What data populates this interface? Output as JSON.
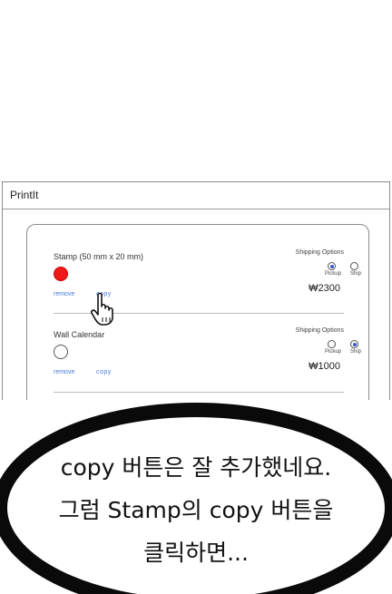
{
  "app": {
    "title": "PrintIt"
  },
  "items": [
    {
      "name": "Stamp (50 mm x 20 mm)",
      "swatch_color": "#ee1a1a",
      "remove_label": "remove",
      "copy_label": "copy",
      "shipping_title": "Shipping Options",
      "options": [
        "Pickup",
        "Ship"
      ],
      "selected_option": "Pickup",
      "price": "₩2300"
    },
    {
      "name": "Wall Calendar",
      "swatch_color": "#ffffff",
      "remove_label": "remove",
      "copy_label": "copy",
      "shipping_title": "Shipping Options",
      "options": [
        "Pickup",
        "Ship"
      ],
      "selected_option": "Ship",
      "price": "₩1000"
    }
  ],
  "speech_bubble": {
    "lines": [
      "copy 버튼은 잘 추가했네요.",
      "그럼 Stamp의 copy 버튼을",
      "클릭하면..."
    ]
  },
  "colors": {
    "link": "#4a78d6",
    "radio_selected": "#3a55c8",
    "stamp_red": "#ee1a1a"
  }
}
